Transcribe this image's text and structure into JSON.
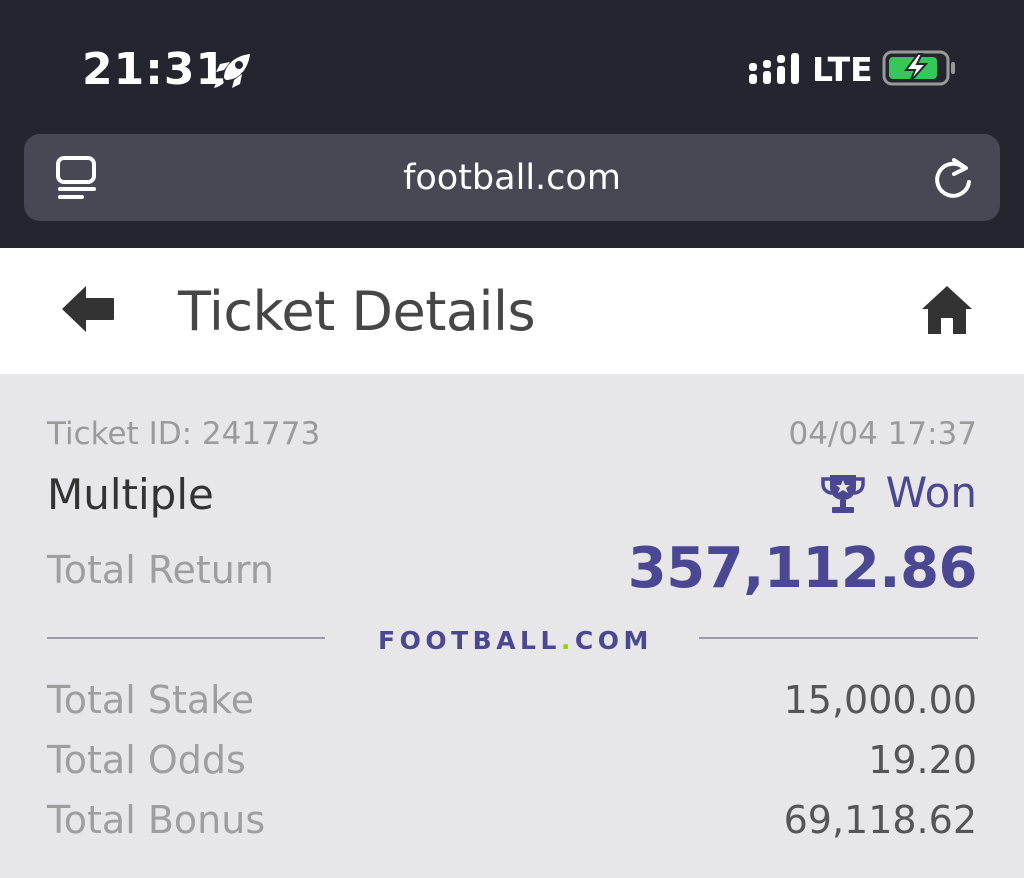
{
  "status_bar": {
    "time": "21:31",
    "network": "LTE",
    "icons": [
      "rocket-icon",
      "signal-icon",
      "battery-charging-icon"
    ]
  },
  "browser": {
    "url": "football.com",
    "icons": [
      "tabs-icon",
      "reload-icon"
    ]
  },
  "header": {
    "title": "Ticket Details",
    "icons": [
      "back-arrow-icon",
      "home-icon"
    ]
  },
  "ticket": {
    "id_text": "Ticket ID: 241773",
    "datetime": "04/04 17:37",
    "bet_type": "Multiple",
    "status": "Won",
    "status_icon": "trophy-icon",
    "total_return_label": "Total Return",
    "total_return_value": "357,112.86",
    "brand": {
      "left": "FOOTBALL",
      "dot": ".",
      "right": "COM"
    },
    "rows": {
      "stake_label": "Total Stake",
      "stake_value": "15,000.00",
      "odds_label": "Total Odds",
      "odds_value": "19.20",
      "bonus_label": "Total Bonus",
      "bonus_value": "69,118.62"
    }
  },
  "colors": {
    "accent": "#4b4792",
    "brand_dot": "#8fd400",
    "chrome_bg": "#25252f",
    "urlbar_bg": "#484854",
    "ticket_bg": "#e7e7e9",
    "battery_green": "#34c759"
  }
}
